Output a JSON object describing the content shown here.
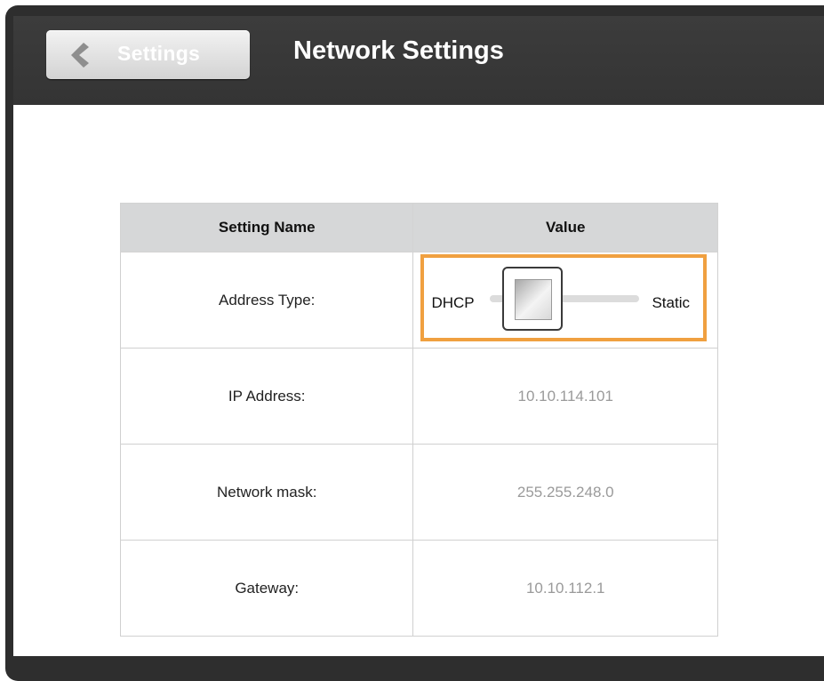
{
  "header": {
    "back_label": "Settings",
    "title": "Network Settings"
  },
  "table": {
    "columns": [
      "Setting Name",
      "Value"
    ],
    "rows": [
      {
        "name": "Address Type:",
        "value": ""
      },
      {
        "name": "IP Address:",
        "value": "10.10.114.101"
      },
      {
        "name": "Network mask:",
        "value": "255.255.248.0"
      },
      {
        "name": "Gateway:",
        "value": "10.10.112.1"
      }
    ]
  },
  "toggle": {
    "left_label": "DHCP",
    "right_label": "Static",
    "selected": "DHCP"
  },
  "colors": {
    "highlight": "#f0a040",
    "header_bar": "#3a3a3a",
    "table_header": "#d6d7d8"
  },
  "icons": {
    "back": "chevron-left-icon"
  }
}
